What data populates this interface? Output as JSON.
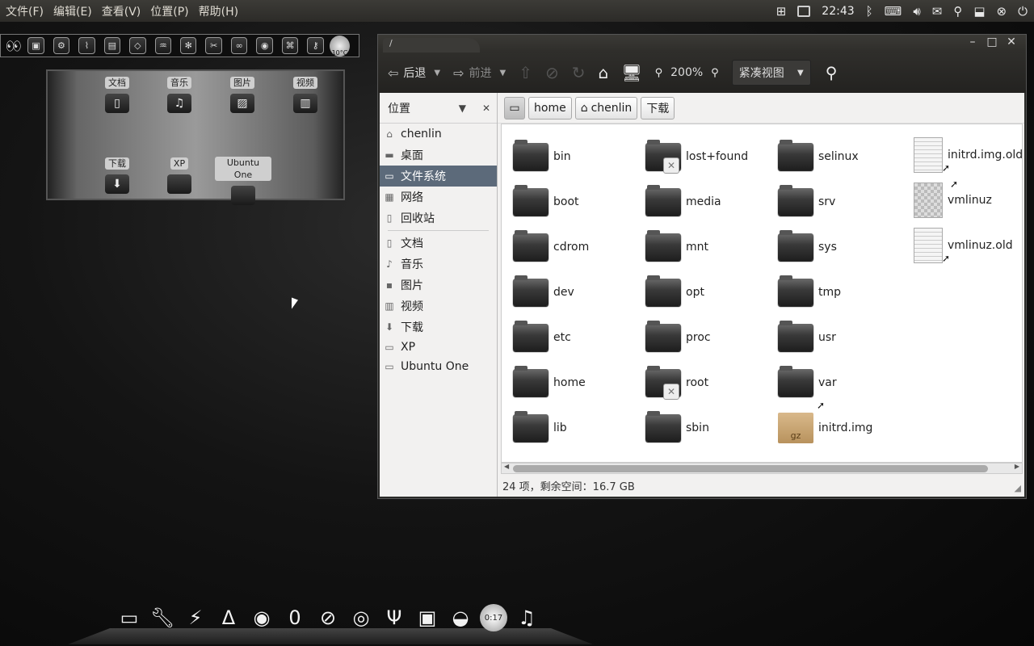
{
  "top_panel": {
    "menus": [
      "文件(F)",
      "编辑(E)",
      "查看(V)",
      "位置(P)",
      "帮助(H)"
    ],
    "clock": "22:43",
    "tray_icons": [
      "network-icon",
      "battery-icon",
      "bluetooth-icon",
      "keyboard-icon",
      "volume-icon",
      "mail-icon",
      "search-icon",
      "dropbox-icon",
      "close-session-icon",
      "power-icon"
    ]
  },
  "mini_dock": {
    "weather": "10°C"
  },
  "places_widget": {
    "items": [
      "文档",
      "音乐",
      "图片",
      "视频",
      "下载",
      "XP",
      "Ubuntu One"
    ]
  },
  "window": {
    "tab_label": "/",
    "toolbar": {
      "back": "后退",
      "forward": "前进",
      "zoom": "200%",
      "view": "紧凑视图"
    },
    "sidebar": {
      "header": "位置",
      "items": [
        {
          "label": "chenlin",
          "icon": "home-icon"
        },
        {
          "label": "桌面",
          "icon": "desktop-icon"
        },
        {
          "label": "文件系统",
          "icon": "drive-icon"
        },
        {
          "label": "网络",
          "icon": "network-icon"
        },
        {
          "label": "回收站",
          "icon": "trash-icon"
        },
        {
          "label": "文档",
          "icon": "document-icon"
        },
        {
          "label": "音乐",
          "icon": "music-icon"
        },
        {
          "label": "图片",
          "icon": "picture-icon"
        },
        {
          "label": "视频",
          "icon": "video-icon"
        },
        {
          "label": "下载",
          "icon": "download-icon"
        },
        {
          "label": "XP",
          "icon": "folder-icon"
        },
        {
          "label": "Ubuntu One",
          "icon": "folder-icon"
        }
      ]
    },
    "pathbar": {
      "crumbs": [
        "home",
        "chenlin",
        "下载"
      ]
    },
    "files": [
      {
        "name": "bin",
        "type": "folder"
      },
      {
        "name": "boot",
        "type": "folder"
      },
      {
        "name": "cdrom",
        "type": "folder"
      },
      {
        "name": "dev",
        "type": "folder"
      },
      {
        "name": "etc",
        "type": "folder"
      },
      {
        "name": "home",
        "type": "folder"
      },
      {
        "name": "lib",
        "type": "folder"
      },
      {
        "name": "lost+found",
        "type": "folder-locked"
      },
      {
        "name": "media",
        "type": "folder"
      },
      {
        "name": "mnt",
        "type": "folder"
      },
      {
        "name": "opt",
        "type": "folder"
      },
      {
        "name": "proc",
        "type": "folder"
      },
      {
        "name": "root",
        "type": "folder-locked"
      },
      {
        "name": "sbin",
        "type": "folder"
      },
      {
        "name": "selinux",
        "type": "folder"
      },
      {
        "name": "srv",
        "type": "folder"
      },
      {
        "name": "sys",
        "type": "folder"
      },
      {
        "name": "tmp",
        "type": "folder"
      },
      {
        "name": "usr",
        "type": "folder"
      },
      {
        "name": "var",
        "type": "folder"
      },
      {
        "name": "initrd.img",
        "type": "archive-link"
      },
      {
        "name": "initrd.img.old",
        "type": "text-link"
      },
      {
        "name": "vmlinuz",
        "type": "binary-link"
      },
      {
        "name": "vmlinuz.old",
        "type": "text-link"
      }
    ],
    "status": "24 项，剩余空间：16.7 GB"
  },
  "dock": {
    "icons": [
      "folder-icon",
      "wrench-icon",
      "lightning-icon",
      "text-editor-icon",
      "firefox-icon",
      "zero-icon",
      "compass-icon",
      "chrome-icon",
      "usb-icon",
      "laptop-icon",
      "pidgin-icon",
      "cd-timer-icon",
      "music-player-icon"
    ],
    "timer": "0:17"
  }
}
